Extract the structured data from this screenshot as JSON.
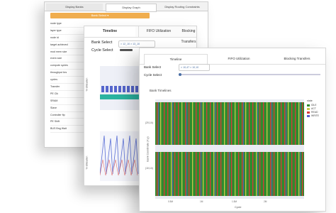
{
  "back_window": {
    "tabs": [
      "Display Banks",
      "Display Graph",
      "Display Routing Constraints"
    ],
    "orange_label": "Bank Select ▾",
    "list": [
      "node type",
      "layer type",
      "node id",
      "target achieved",
      "mod mem size",
      "exem size",
      "compute cycles",
      "throughput brs",
      "cycles",
      "Transfer",
      "PE Clk",
      "SRAM",
      "Slave",
      "Controller ftp",
      "PE Shift",
      "BUS Bng Wait"
    ]
  },
  "middle_window": {
    "tabs": [
      "Timeline",
      "FIFO Utilization",
      "Blocking Transfers"
    ],
    "bank_select_label": "Bank Select",
    "cycle_select_label": "Cycle Select",
    "bank_select_value": "× 12_10  × 13_10",
    "chart1_ylabel": "% Utilization",
    "chart2_ylabel": "% Utilization"
  },
  "front_window": {
    "tabs": [
      "Timeline",
      "FIFO Utilization",
      "Blocking Transfers"
    ],
    "bank_select_label": "Bank Select",
    "cycle_select_label": "Cycle Select",
    "bank_select_value": "× 10,47  × 10,10",
    "chart_title": "Bank Timelines",
    "ylabel": "Bank Coordinate (X,y)",
    "xlabel": "Cycle",
    "ytick_top": "(20,14)",
    "ytick_bottom": "(10,14)",
    "legend_title": "state",
    "legend": [
      {
        "name": "IDLE",
        "color": "#2e8b2e"
      },
      {
        "name": "ACT",
        "color": "#c8c84a"
      },
      {
        "name": "READ",
        "color": "#d83a3a"
      },
      {
        "name": "WRITE",
        "color": "#5a5ad0"
      }
    ]
  }
}
